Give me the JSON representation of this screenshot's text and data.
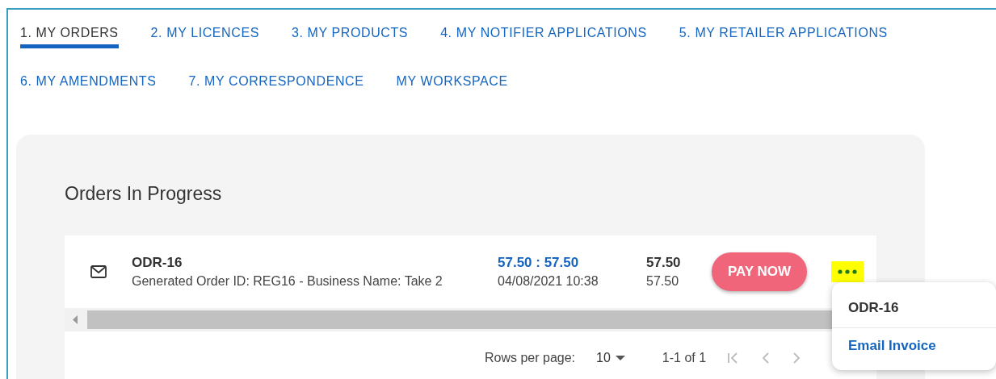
{
  "tabs": [
    {
      "label": "1. MY ORDERS",
      "selected": true
    },
    {
      "label": "2. MY LICENCES",
      "selected": false
    },
    {
      "label": "3. MY PRODUCTS",
      "selected": false
    },
    {
      "label": "4. MY NOTIFIER APPLICATIONS",
      "selected": false
    },
    {
      "label": "5. MY RETAILER APPLICATIONS",
      "selected": false
    },
    {
      "label": "6. MY AMENDMENTS",
      "selected": false
    },
    {
      "label": "7. MY CORRESPONDENCE",
      "selected": false
    },
    {
      "label": "MY WORKSPACE",
      "selected": false
    }
  ],
  "section_title": "Orders In Progress",
  "orders": [
    {
      "id": "ODR-16",
      "description": "Generated Order ID: REG16 - Business Name: Take 2",
      "amount_ratio": "57.50 : 57.50",
      "date": "04/08/2021 10:38",
      "total": "57.50",
      "total_secondary": "57.50",
      "action": "PAY NOW"
    }
  ],
  "pagination": {
    "rows_per_page_label": "Rows per page:",
    "rows_per_page": "10",
    "range": "1-1 of 1"
  },
  "menu": {
    "title": "ODR-16",
    "items": [
      "Email Invoice"
    ]
  }
}
